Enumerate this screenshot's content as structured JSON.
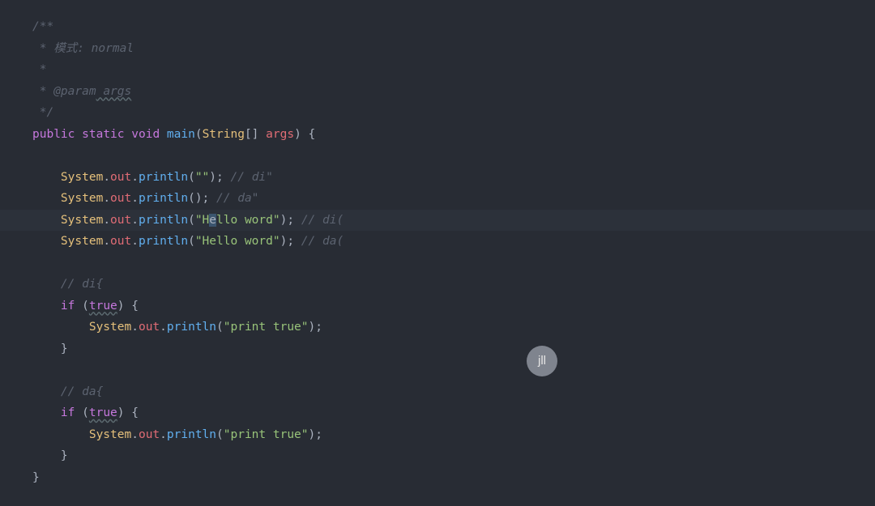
{
  "javadoc": {
    "open": "/**",
    "l1_star": " * ",
    "l1_text": "模式: normal",
    "l2": " *",
    "l3_star": " * ",
    "l3_tag": "@param",
    "l3_arg": " args",
    "close": " */"
  },
  "sig": {
    "public": "public",
    "static": "static",
    "void": "void",
    "main": "main",
    "lp": "(",
    "String": "String",
    "brackets": "[] ",
    "args": "args",
    "rp_brace": ") {"
  },
  "s1": {
    "System": "System",
    "dot1": ".",
    "out": "out",
    "dot2": ".",
    "println": "println",
    "lp": "(",
    "str": "\"\"",
    "rp_semi": ");",
    "sp": " ",
    "comment": "// di\""
  },
  "s2": {
    "System": "System",
    "dot1": ".",
    "out": "out",
    "dot2": ".",
    "println": "println",
    "parens_semi": "();",
    "sp": " ",
    "comment": "// da\""
  },
  "s3": {
    "System": "System",
    "dot1": ".",
    "out": "out",
    "dot2": ".",
    "println": "println",
    "lp": "(",
    "q_pre": "\"H",
    "sel": "e",
    "q_post": "llo word\"",
    "rp_semi": ");",
    "sp": " ",
    "comment": "// di("
  },
  "s4": {
    "System": "System",
    "dot1": ".",
    "out": "out",
    "dot2": ".",
    "println": "println",
    "lp": "(",
    "str": "\"Hello word\"",
    "rp_semi": ");",
    "sp": " ",
    "comment": "// da("
  },
  "c_di_brace": "// di{",
  "if1": {
    "if": "if",
    "sp_lp": " (",
    "true": "true",
    "rp_sp_brace": ") {"
  },
  "p1": {
    "System": "System",
    "dot1": ".",
    "out": "out",
    "dot2": ".",
    "println": "println",
    "lp": "(",
    "str": "\"print true\"",
    "rp_semi": ");"
  },
  "brace_close": "}",
  "c_da_brace": "// da{",
  "if2": {
    "if": "if",
    "sp_lp": " (",
    "true": "true",
    "rp_sp_brace": ") {"
  },
  "p2": {
    "System": "System",
    "dot1": ".",
    "out": "out",
    "dot2": ".",
    "println": "println",
    "lp": "(",
    "str": "\"print true\"",
    "rp_semi": ");"
  },
  "badge": "jll"
}
